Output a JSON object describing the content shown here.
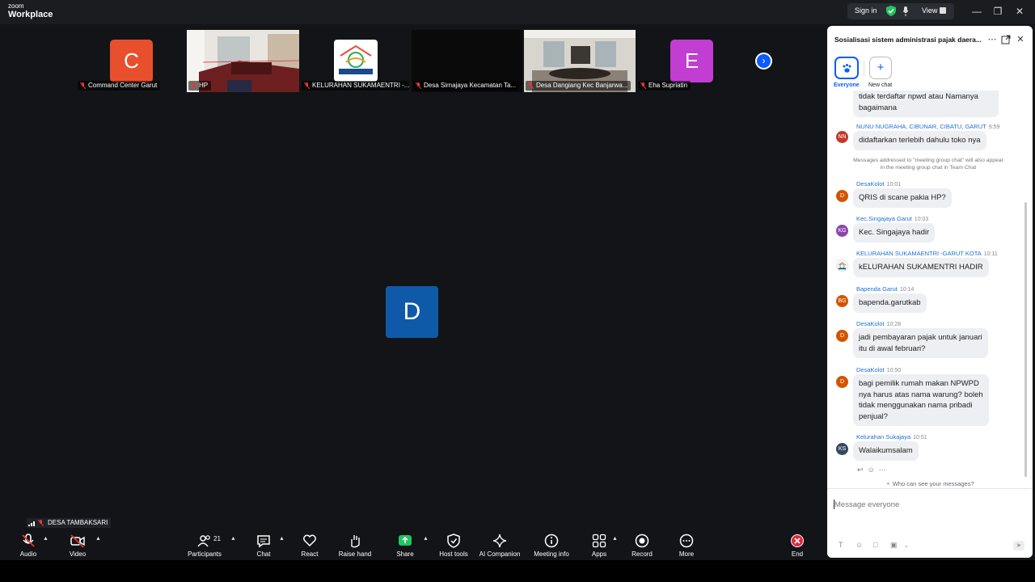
{
  "app": {
    "brand_small": "zoom",
    "brand_main": "Workplace"
  },
  "titlebar": {
    "signin": "Sign in",
    "view": "View"
  },
  "thumbnails": [
    {
      "name": "Command Center Garut",
      "avatar": "C",
      "color": "#e8502d"
    },
    {
      "name": "HP"
    },
    {
      "name": "KELURAHAN SUKAMAENTRI -..."
    },
    {
      "name": "Desa Sirnajaya Kecamatan Ta..."
    },
    {
      "name": "Desa Dangiang Kec Banjarwa..."
    },
    {
      "name": "Eha Supriatin",
      "avatar": "E",
      "color": "#c23ed2"
    }
  ],
  "main_speaker": {
    "avatar": "D",
    "name": "DESA TAMBAKSARI"
  },
  "toolbar": {
    "audio": "Audio",
    "video": "Video",
    "participants": "Participants",
    "participants_count": "21",
    "chat": "Chat",
    "react": "React",
    "raise_hand": "Raise hand",
    "share": "Share",
    "host_tools": "Host tools",
    "ai_companion": "AI Companion",
    "meeting_info": "Meeting info",
    "apps": "Apps",
    "record": "Record",
    "more": "More",
    "end": "End"
  },
  "chat": {
    "title": "Sosialisasi sistem administrasi pajak daera...",
    "tabs": {
      "everyone": "Everyone",
      "new_chat": "New chat"
    },
    "partial_top": "tidak terdaftar npwd atau Namanya\nbagaimana",
    "system_note": "Messages addressed to \"meeting group chat\" will also appear in the meeting group chat in Team Chat",
    "messages": [
      {
        "initials": "NN",
        "color": "#c0392b",
        "sender": "NUNU NUGRAHA, CIBUNAR, CIBATU, GARUT",
        "time": "9:59",
        "text": "didaftarkan terlebih dahulu toko nya"
      },
      {
        "initials": "D",
        "color": "#d35400",
        "sender": "DesaKolot",
        "time": "10:01",
        "text": "QRIS di scane pakia HP?"
      },
      {
        "initials": "KG",
        "color": "#8e44ad",
        "sender": "Kec.Singajaya Garut",
        "time": "10:03",
        "text": "Kec. Singajaya hadir"
      },
      {
        "initials": "",
        "color": "#ddd",
        "sender": "KELURAHAN SUKAMAENTRI -GARUT KOTA",
        "time": "10:11",
        "text": "kELURAHAN SUKAMENTRI HADIR"
      },
      {
        "initials": "BG",
        "color": "#d35400",
        "sender": "Bapenda Garut",
        "time": "10:14",
        "text": "bapenda.garutkab"
      },
      {
        "initials": "D",
        "color": "#d35400",
        "sender": "DesaKolot",
        "time": "10:28",
        "text": "jadi pembayaran pajak untuk januari\nitu di awal februari?"
      },
      {
        "initials": "D",
        "color": "#d35400",
        "sender": "DesaKolot",
        "time": "10:50",
        "text": "bagi pemilik rumah makan NPWPD\nnya harus atas nama warung? boleh\ntidak menggunakan nama pribadi\npenjual?"
      },
      {
        "initials": "KS",
        "color": "#34495e",
        "sender": "Kelurahan Sukajaya",
        "time": "10:51",
        "text": "Walaikumsalam"
      }
    ],
    "who_can_see": "Who can see your messages?",
    "input_placeholder": "Message everyone"
  }
}
